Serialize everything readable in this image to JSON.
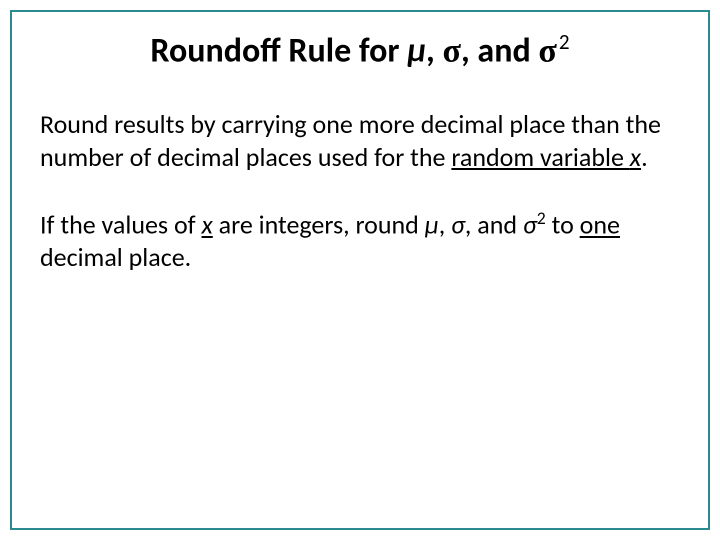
{
  "title": {
    "prefix": "Roundoff Rule for ",
    "mu": "µ",
    "sep1": ", ",
    "sigma": "σ",
    "sep2": ", and ",
    "sigma2": "σ",
    "exp": "2"
  },
  "para1": {
    "t1": "Round results by carrying one more decimal place than the number of decimal places used for the ",
    "rv": "random variable ",
    "x": "x",
    "period": "."
  },
  "para2": {
    "t1": "If the values of ",
    "x": "x",
    "t2": " are integers, round ",
    "mu": "µ",
    "sep1": ", ",
    "sigma": "σ",
    "sep2": ", and ",
    "sigma2": "σ",
    "exp": "2",
    "t3": " to ",
    "one": "one",
    "t4": " decimal place."
  }
}
